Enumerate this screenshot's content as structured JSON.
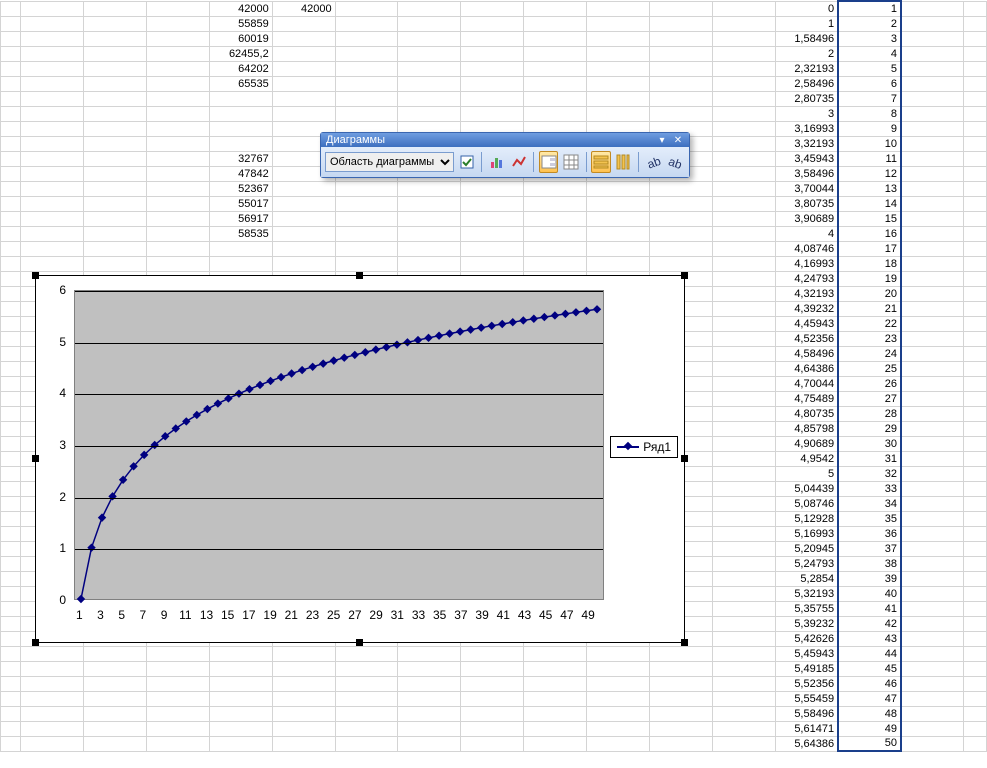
{
  "spreadsheet": {
    "colA": [
      "42000",
      "55859",
      "60019",
      "62455,2",
      "64202",
      "65535"
    ],
    "colB": [
      "42000"
    ],
    "colA2": [
      "32767",
      "47842",
      "52367",
      "55017",
      "56917",
      "58535"
    ],
    "data_pairs": [
      [
        "0",
        "1"
      ],
      [
        "1",
        "2"
      ],
      [
        "1,58496",
        "3"
      ],
      [
        "2",
        "4"
      ],
      [
        "2,32193",
        "5"
      ],
      [
        "2,58496",
        "6"
      ],
      [
        "2,80735",
        "7"
      ],
      [
        "3",
        "8"
      ],
      [
        "3,16993",
        "9"
      ],
      [
        "3,32193",
        "10"
      ],
      [
        "3,45943",
        "11"
      ],
      [
        "3,58496",
        "12"
      ],
      [
        "3,70044",
        "13"
      ],
      [
        "3,80735",
        "14"
      ],
      [
        "3,90689",
        "15"
      ],
      [
        "4",
        "16"
      ],
      [
        "4,08746",
        "17"
      ],
      [
        "4,16993",
        "18"
      ],
      [
        "4,24793",
        "19"
      ],
      [
        "4,32193",
        "20"
      ],
      [
        "4,39232",
        "21"
      ],
      [
        "4,45943",
        "22"
      ],
      [
        "4,52356",
        "23"
      ],
      [
        "4,58496",
        "24"
      ],
      [
        "4,64386",
        "25"
      ],
      [
        "4,70044",
        "26"
      ],
      [
        "4,75489",
        "27"
      ],
      [
        "4,80735",
        "28"
      ],
      [
        "4,85798",
        "29"
      ],
      [
        "4,90689",
        "30"
      ],
      [
        "4,9542",
        "31"
      ],
      [
        "5",
        "32"
      ],
      [
        "5,04439",
        "33"
      ],
      [
        "5,08746",
        "34"
      ],
      [
        "5,12928",
        "35"
      ],
      [
        "5,16993",
        "36"
      ],
      [
        "5,20945",
        "37"
      ],
      [
        "5,24793",
        "38"
      ],
      [
        "5,2854",
        "39"
      ],
      [
        "5,32193",
        "40"
      ],
      [
        "5,35755",
        "41"
      ],
      [
        "5,39232",
        "42"
      ],
      [
        "5,42626",
        "43"
      ],
      [
        "5,45943",
        "44"
      ],
      [
        "5,49185",
        "45"
      ],
      [
        "5,52356",
        "46"
      ],
      [
        "5,55459",
        "47"
      ],
      [
        "5,58496",
        "48"
      ],
      [
        "5,61471",
        "49"
      ],
      [
        "5,64386",
        "50"
      ]
    ]
  },
  "toolbar": {
    "title": "Диаграммы",
    "dropdown_value": "Область диаграммы"
  },
  "chart_data": {
    "type": "line",
    "series": [
      {
        "name": "Ряд1",
        "values": [
          0,
          1,
          1.58496,
          2,
          2.32193,
          2.58496,
          2.80735,
          3,
          3.16993,
          3.32193,
          3.45943,
          3.58496,
          3.70044,
          3.80735,
          3.90689,
          4,
          4.08746,
          4.16993,
          4.24793,
          4.32193,
          4.39232,
          4.45943,
          4.52356,
          4.58496,
          4.64386,
          4.70044,
          4.75489,
          4.80735,
          4.85798,
          4.90689,
          4.9542,
          5,
          5.04439,
          5.08746,
          5.12928,
          5.16993,
          5.20945,
          5.24793,
          5.2854,
          5.32193,
          5.35755,
          5.39232,
          5.42626,
          5.45943,
          5.49185,
          5.52356,
          5.55459,
          5.58496,
          5.61471,
          5.64386
        ]
      }
    ],
    "x_ticks": [
      1,
      3,
      5,
      7,
      9,
      11,
      13,
      15,
      17,
      19,
      21,
      23,
      25,
      27,
      29,
      31,
      33,
      35,
      37,
      39,
      41,
      43,
      45,
      47,
      49
    ],
    "y_ticks": [
      0,
      1,
      2,
      3,
      4,
      5,
      6
    ],
    "ylim": [
      0,
      6
    ],
    "legend": "Ряд1"
  }
}
